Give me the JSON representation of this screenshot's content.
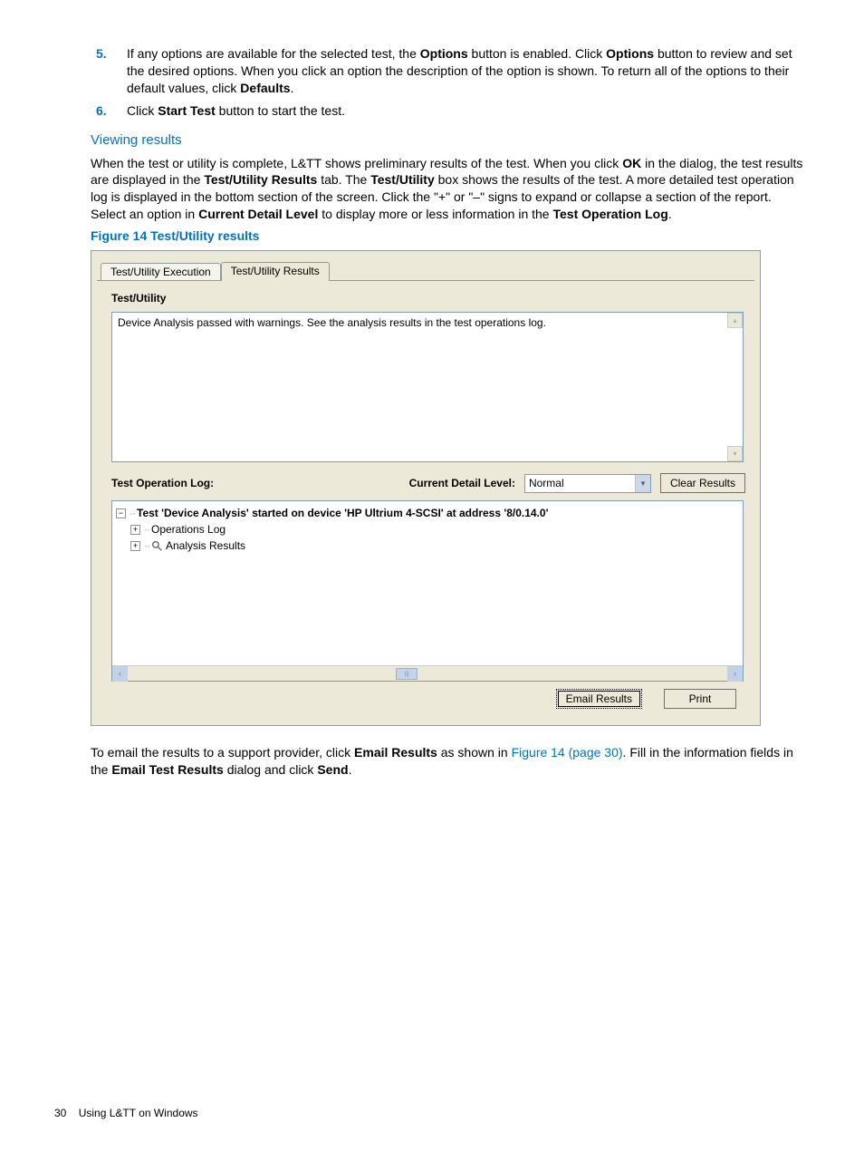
{
  "list": {
    "item5_pre": "If any options are available for the selected test, the ",
    "item5_b1": "Options",
    "item5_mid1": " button is enabled. Click ",
    "item5_b2": "Options",
    "item5_mid2": " button to review and set the desired options. When you click an option the description of the option is shown. To return all of the options to their default values, click ",
    "item5_b3": "Defaults",
    "item5_end": ".",
    "item6_pre": "Click ",
    "item6_b1": "Start Test",
    "item6_end": " button to start the test."
  },
  "heading_viewing": "Viewing results",
  "para1": {
    "p1": "When the test or utility is complete, L&TT shows preliminary results of the test. When you click ",
    "b1": "OK",
    "p2": " in the dialog, the test results are displayed in the ",
    "b2": "Test/Utility Results",
    "p3": " tab. The ",
    "b3": "Test/Utility",
    "p4": " box shows the results of the test. A more detailed test operation log is displayed in the bottom section of the screen. Click the \"+\" or \"–\" signs to expand or collapse a section of the report. Select an option in ",
    "b4": "Current Detail Level",
    "p5": " to display more or less information in the ",
    "b5": "Test Operation Log",
    "p6": "."
  },
  "figure_caption": "Figure 14 Test/Utility results",
  "sshot": {
    "tab_exec": "Test/Utility Execution",
    "tab_results": "Test/Utility Results",
    "group_label": "Test/Utility",
    "analysis_text": "Device Analysis passed with warnings. See the analysis results in the test operations log.",
    "log_label": "Test Operation Log:",
    "detail_label": "Current Detail Level:",
    "detail_value": "Normal",
    "clear_btn": "Clear Results",
    "tree_root": "Test 'Device Analysis' started on device 'HP Ultrium 4-SCSI' at address '8/0.14.0'",
    "tree_ops": "Operations Log",
    "tree_analysis": "Analysis Results",
    "email_btn": "Email Results",
    "print_btn": "Print"
  },
  "para2": {
    "p1": "To email the results to a support provider, click ",
    "b1": "Email Results",
    "p2": " as shown in ",
    "link": "Figure 14 (page 30)",
    "p3": ". Fill in the information fields in the ",
    "b2": "Email Test Results",
    "p4": " dialog and click ",
    "b3": "Send",
    "p5": "."
  },
  "footer_page": "30",
  "footer_text": "Using L&TT on Windows",
  "glyphs": {
    "minus": "−",
    "plus": "+",
    "up": "▴",
    "down": "▾",
    "dropdown": "▼",
    "left": "‹",
    "right": "›",
    "thumb": "|||"
  }
}
